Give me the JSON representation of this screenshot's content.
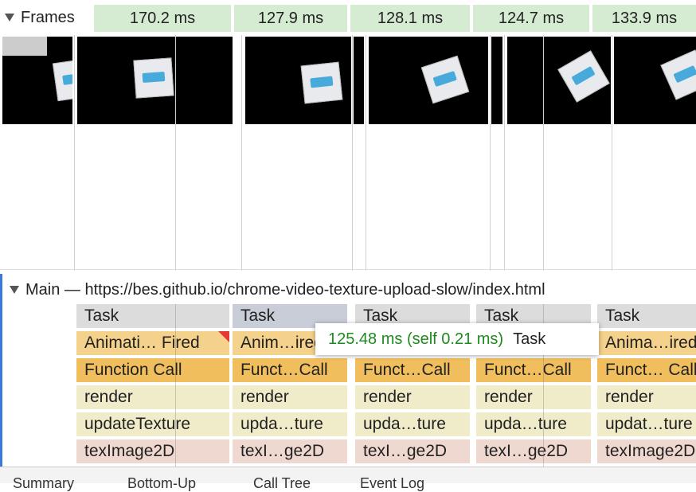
{
  "frames": {
    "label": "Frames",
    "durations": [
      "170.2 ms",
      "127.9 ms",
      "128.1 ms",
      "124.7 ms",
      "133.9 ms"
    ]
  },
  "main": {
    "title": "Main — https://bes.github.io/chrome-video-texture-upload-slow/index.html",
    "columns": [
      {
        "task": "Task",
        "anim": "Animati… Fired",
        "func": "Function Call",
        "render": "render",
        "update": "updateTexture",
        "tex": "texImage2D"
      },
      {
        "task": "Task",
        "anim": "Anim…ired",
        "func": "Funct…Call",
        "render": "render",
        "update": "upda…ture",
        "tex": "texI…ge2D"
      },
      {
        "task": "Task",
        "anim": "",
        "func": "Funct…Call",
        "render": "render",
        "update": "upda…ture",
        "tex": "texI…ge2D"
      },
      {
        "task": "Task",
        "anim": "",
        "func": "Funct…Call",
        "render": "render",
        "update": "upda…ture",
        "tex": "texI…ge2D"
      },
      {
        "task": "Task",
        "anim": "Anima…ired",
        "func": "Funct… Call",
        "render": "render",
        "update": "updat…ture",
        "tex": "texImage2D"
      }
    ]
  },
  "tooltip": {
    "time": "125.48 ms (self 0.21 ms)",
    "name": "Task"
  },
  "bottom_tabs": [
    "Summary",
    "Bottom-Up",
    "Call Tree",
    "Event Log"
  ]
}
